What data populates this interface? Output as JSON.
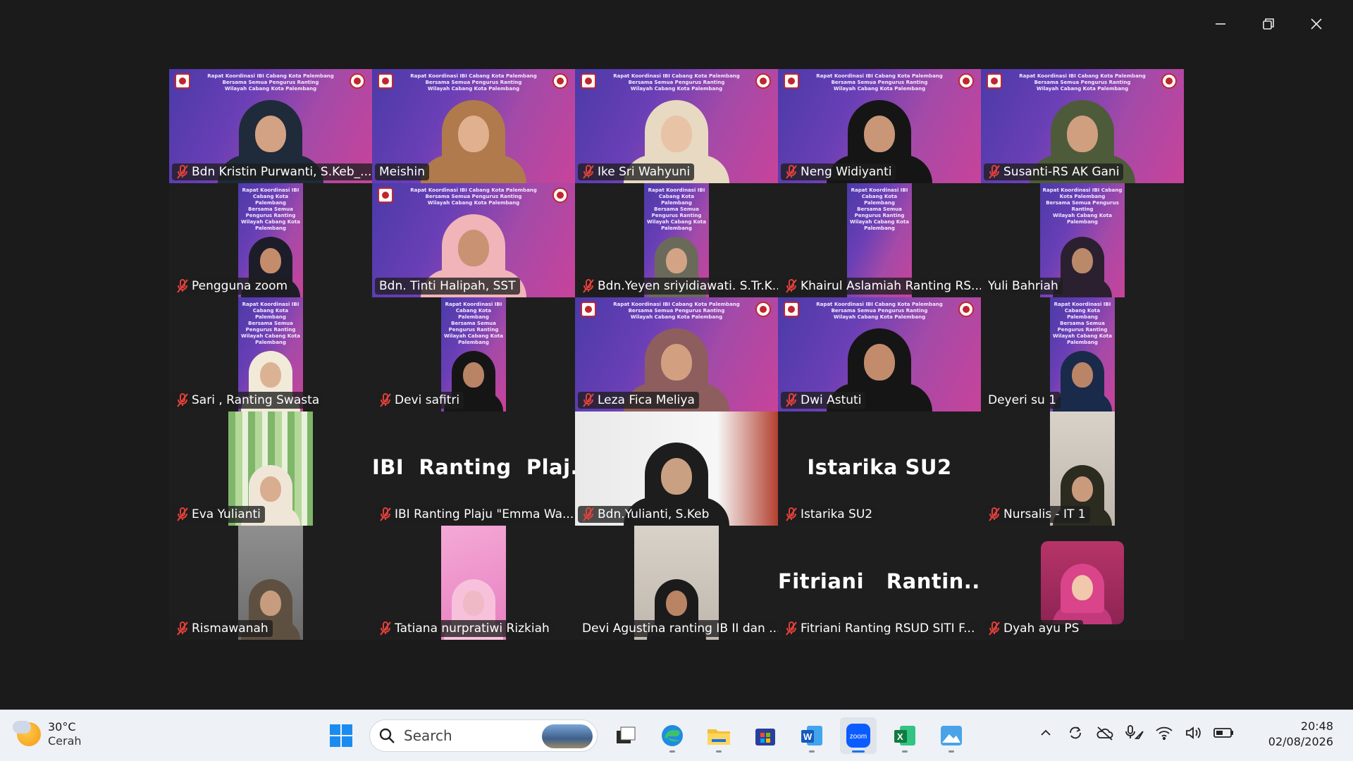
{
  "window": {
    "minimize_icon": "minimize-icon",
    "restore_icon": "restore-icon",
    "close_icon": "close-icon"
  },
  "banner_text": "Rapat Koordinasi IBI Cabang Kota Palembang\nBersama Semua Pengurus Ranting\nWilayah Cabang Kota Palembang",
  "participants": [
    {
      "name": "Bdn Kristin Purwanti, S.Keb_...",
      "muted": true
    },
    {
      "name": "Meishin",
      "muted": false,
      "active_speaker": true
    },
    {
      "name": "Ike Sri Wahyuni",
      "muted": true
    },
    {
      "name": "Neng Widiyanti",
      "muted": true
    },
    {
      "name": "Susanti-RS AK Gani",
      "muted": true
    },
    {
      "name": "Pengguna zoom",
      "muted": true
    },
    {
      "name": "Bdn. Tinti Halipah, SST",
      "muted": false
    },
    {
      "name": "Bdn.Yeyen sriyidiawati. S.Tr.K...",
      "muted": true
    },
    {
      "name": "Khairul Aslamiah Ranting RS...",
      "muted": true
    },
    {
      "name": "Yuli Bahriah",
      "muted": false
    },
    {
      "name": "Sari , Ranting Swasta",
      "muted": true
    },
    {
      "name": "Devi safitri",
      "muted": true
    },
    {
      "name": "Leza Fica Meliya",
      "muted": true
    },
    {
      "name": "Dwi Astuti",
      "muted": true
    },
    {
      "name": "Deyeri su 1",
      "muted": false
    },
    {
      "name": "Eva Yulianti",
      "muted": true
    },
    {
      "name": "IBI Ranting Plaju \"Emma Wa...",
      "muted": true,
      "display_name": "IBI  Ranting  Plaj..."
    },
    {
      "name": "Bdn.Yulianti, S.Keb",
      "muted": true
    },
    {
      "name": "Istarika SU2",
      "muted": true,
      "display_name": "Istarika SU2"
    },
    {
      "name": "Nursalis - IT 1",
      "muted": true
    },
    {
      "name": "Rismawanah",
      "muted": true
    },
    {
      "name": "Tatiana nurpratiwi Rizkiah",
      "muted": true
    },
    {
      "name": "Devi Agustina ranting IB II dan ...",
      "muted": false
    },
    {
      "name": "Fitriani  Ranting RSUD SITI F...",
      "muted": true,
      "display_name": "Fitriani   Rantin..."
    },
    {
      "name": "Dyah ayu PS",
      "muted": true
    }
  ],
  "taskbar": {
    "weather_temp": "30°C",
    "weather_desc": "Cerah",
    "search_placeholder": "Search",
    "apps": [
      "windows-start",
      "search",
      "task-view",
      "edge",
      "file-explorer",
      "microsoft-store",
      "word",
      "zoom",
      "excel",
      "photos"
    ],
    "active_app": "zoom",
    "time": "20:48",
    "date": "02/08/2026",
    "zoom_label": "zoom",
    "accent": "#1a73e8"
  },
  "colors": {
    "active_speaker_border": "#23d18b",
    "tile_background": "#1e1e1e",
    "muted_mic": "#e0403a"
  }
}
